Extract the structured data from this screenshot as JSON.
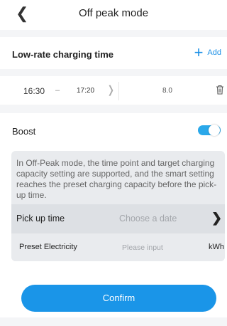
{
  "header": {
    "back_icon": "chevron-left-icon",
    "title": "Off peak mode"
  },
  "low_rate": {
    "section_title": "Low-rate charging time",
    "add_label": "Add",
    "rows": [
      {
        "start": "16:30",
        "separator": "–",
        "end": "17:20",
        "value": "8.0"
      }
    ]
  },
  "boost": {
    "label": "Boost",
    "enabled": true
  },
  "info": {
    "description": "In Off-Peak mode, the time point and target charging capacity setting are supported, and the smart setting reaches the preset charging capacity before the pick-up time.",
    "pick_up": {
      "label": "Pick up time",
      "placeholder": "Choose a date"
    },
    "preset": {
      "label": "Preset Electricity",
      "placeholder": "Please input",
      "unit": "kWh"
    }
  },
  "confirm_label": "Confirm",
  "colors": {
    "accent": "#1a95e8",
    "toggle": "#2aa8ea",
    "background_gray": "#f4f5f7"
  }
}
